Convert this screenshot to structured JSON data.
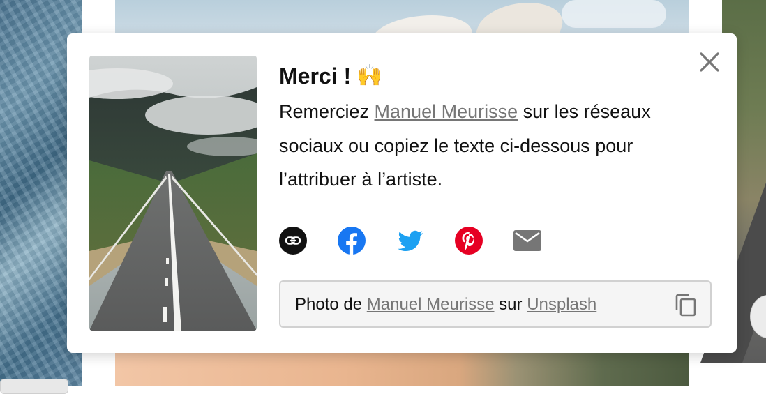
{
  "modal": {
    "title": "Merci !",
    "title_emoji": "🙌",
    "desc_before": "Remerciez ",
    "artist_name": "Manuel Meurisse",
    "desc_after": " sur les réseaux sociaux ou copiez le texte ci-dessous pour l’attribuer à l’artiste.",
    "close_icon": "close-icon",
    "share_icons": [
      "link-icon",
      "facebook-icon",
      "twitter-icon",
      "pinterest-icon",
      "email-icon"
    ],
    "credit": {
      "prefix": "Photo de ",
      "artist": "Manuel Meurisse",
      "middle": " sur ",
      "site": "Unsplash",
      "copy_icon": "copy-icon"
    }
  },
  "colors": {
    "facebook": "#1877f2",
    "twitter": "#1da1f2",
    "pinterest": "#e60023",
    "email": "#767676",
    "link": "#111111"
  }
}
